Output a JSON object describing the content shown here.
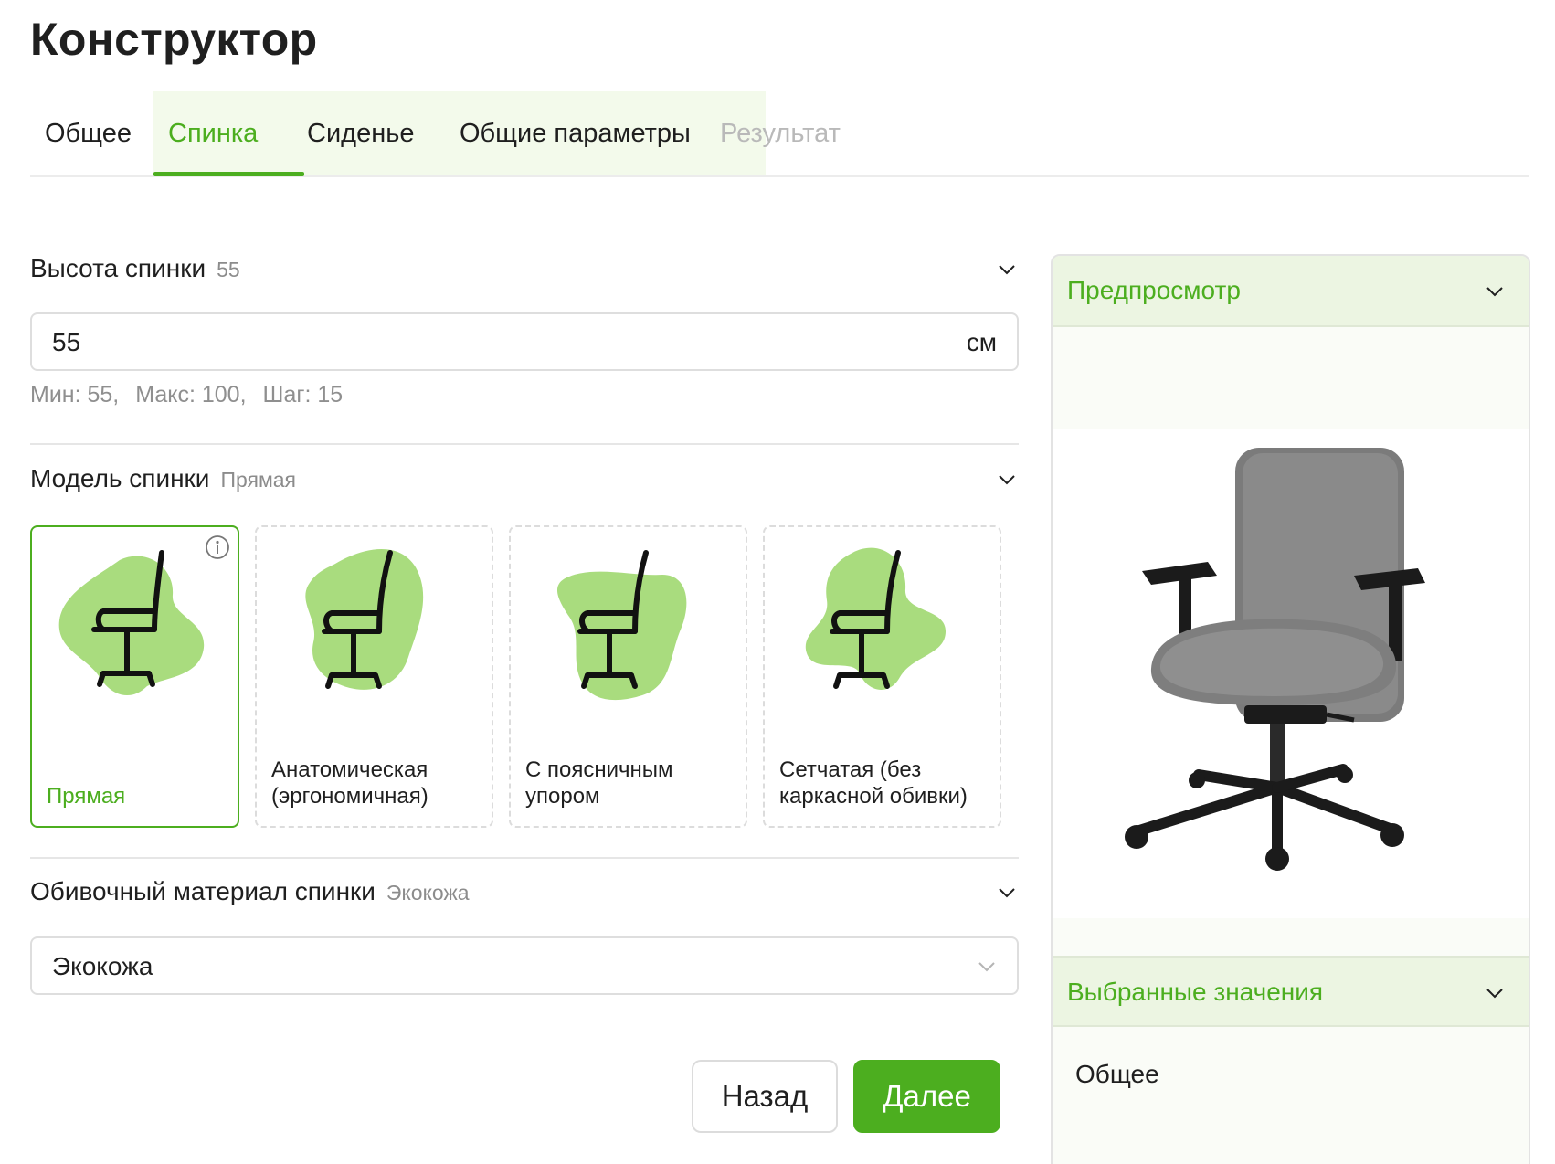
{
  "page": {
    "title": "Конструктор"
  },
  "tabs": [
    {
      "label": "Общее",
      "state": "default"
    },
    {
      "label": "Спинка",
      "state": "active"
    },
    {
      "label": "Сиденье",
      "state": "default"
    },
    {
      "label": "Общие параметры",
      "state": "default"
    },
    {
      "label": "Результат",
      "state": "disabled"
    }
  ],
  "accent_color": "#4cae1f",
  "back_height": {
    "title": "Высота спинки",
    "selected": "55",
    "input_value": "55",
    "unit": "см",
    "hint_min": "Мин: 55,",
    "hint_max": "Макс: 100,",
    "hint_step": "Шаг: 15"
  },
  "back_model": {
    "title": "Модель спинки",
    "selected": "Прямая",
    "options": [
      {
        "label": "Прямая",
        "selected": true
      },
      {
        "label": "Анатомическая (эргономичная)",
        "selected": false
      },
      {
        "label": "С поясничным упором",
        "selected": false
      },
      {
        "label": "Сетчатая (без каркасной обивки)",
        "selected": false
      }
    ]
  },
  "back_material": {
    "title": "Обивочный материал спинки",
    "selected": "Экокожа",
    "select_value": "Экокожа"
  },
  "buttons": {
    "back": "Назад",
    "next": "Далее"
  },
  "sidebar": {
    "preview_title": "Предпросмотр",
    "selected_title": "Выбранные значения",
    "first_group": "Общее"
  }
}
